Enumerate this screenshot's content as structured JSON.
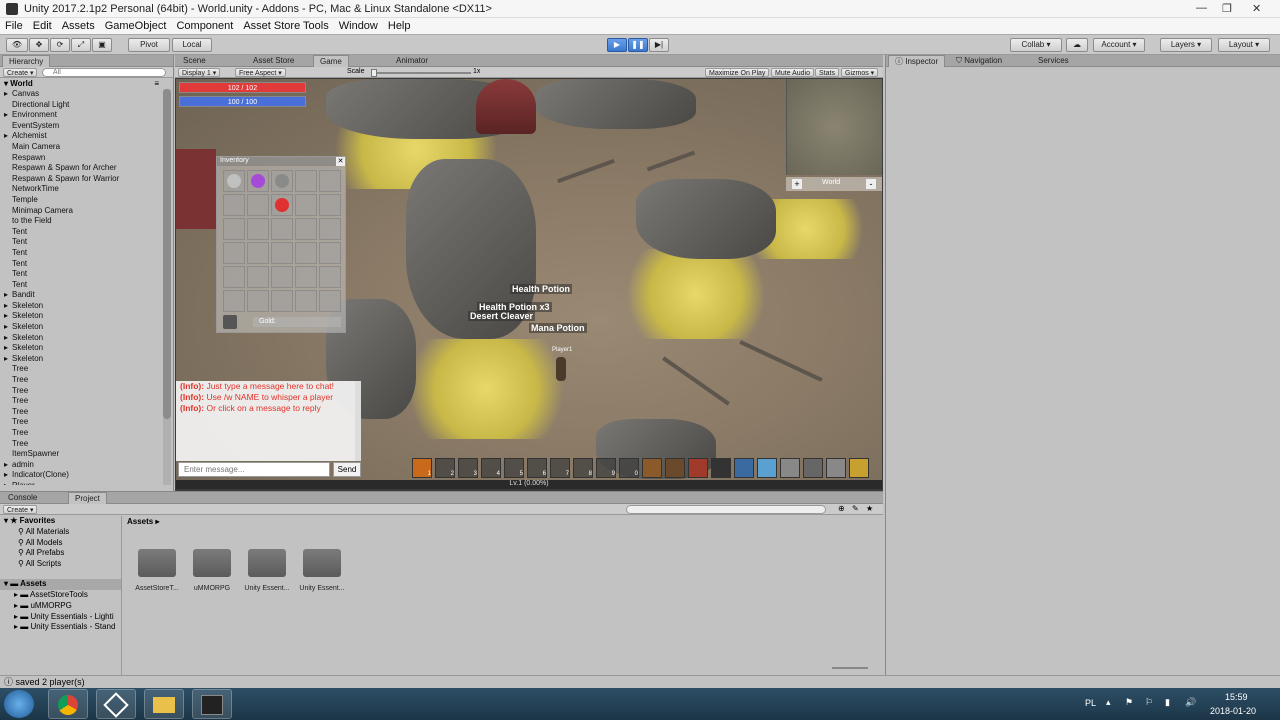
{
  "window": {
    "title": "Unity 2017.2.1p2 Personal (64bit) - World.unity - Addons - PC, Mac & Linux Standalone <DX11>"
  },
  "menu": [
    "File",
    "Edit",
    "Assets",
    "GameObject",
    "Component",
    "Asset Store Tools",
    "Window",
    "Help"
  ],
  "toolbar": {
    "pivot": "Pivot",
    "local": "Local",
    "collab": "Collab",
    "account": "Account",
    "layers": "Layers",
    "layout": "Layout"
  },
  "hierarchy": {
    "tab": "Hierarchy",
    "create": "Create",
    "search_placeholder": "All",
    "scene": "World",
    "items": [
      "Canvas",
      "Directional Light",
      "Environment",
      "EventSystem",
      "Alchemist",
      "Main Camera",
      "Respawn",
      "Respawn & Spawn for Archer",
      "Respawn & Spawn for Warrior",
      "NetworkTime",
      "Temple",
      "Minimap Camera",
      "to the Field",
      "Tent",
      "Tent",
      "Tent",
      "Tent",
      "Tent",
      "Tent",
      "Bandit",
      "Skeleton",
      "Skeleton",
      "Skeleton",
      "Skeleton",
      "Skeleton",
      "Skeleton",
      "Tree",
      "Tree",
      "Tree",
      "Tree",
      "Tree",
      "Tree",
      "Tree",
      "Tree",
      "ItemSpawner",
      "admin",
      "Indicator(Clone)",
      "Player"
    ]
  },
  "view_tabs": [
    "Scene",
    "Asset Store",
    "Game",
    "Animator"
  ],
  "game_bar": {
    "display": "Display 1",
    "aspect": "Free Aspect",
    "scale_label": "Scale",
    "scale": "1x",
    "maximize": "Maximize On Play",
    "mute": "Mute Audio",
    "stats": "Stats",
    "gizmos": "Gizmos"
  },
  "game": {
    "hp": "102 / 102",
    "mp": "100 / 100",
    "inventory_title": "Inventory",
    "gold_label": "Gold:",
    "labels": [
      "Health Potion",
      "Health Potion x3",
      "Desert Cleaver",
      "Mana Potion"
    ],
    "player_name": "Player1",
    "minimap_label": "World",
    "chat": [
      {
        "tag": "(Info):",
        "text": "Just type a message here to chat!"
      },
      {
        "tag": "(Info):",
        "text": "Use /w NAME to whisper a player"
      },
      {
        "tag": "(Info):",
        "text": "Or click on a message to reply"
      }
    ],
    "chat_placeholder": "Enter message...",
    "send": "Send",
    "skill_numbers": [
      "1",
      "2",
      "3",
      "4",
      "5",
      "6",
      "7",
      "8",
      "9",
      "0"
    ],
    "level": "Lv.1 (0.00%)"
  },
  "inspector_tabs": [
    "Inspector",
    "Navigation",
    "Services"
  ],
  "bottom_tabs": [
    "Console",
    "Project"
  ],
  "project": {
    "create": "Create",
    "favorites": "Favorites",
    "fav_items": [
      "All Materials",
      "All Models",
      "All Prefabs",
      "All Scripts"
    ],
    "assets_root": "Assets",
    "tree": [
      "AssetStoreTools",
      "uMMORPG",
      "Unity Essentials - Lighti",
      "Unity Essentials - Stand"
    ],
    "breadcrumb": "Assets",
    "folders": [
      "AssetStoreT...",
      "uMMORPG",
      "Unity Essent...",
      "Unity Essent..."
    ]
  },
  "status": "saved 2 player(s)",
  "taskbar": {
    "lang": "PL",
    "time": "15:59",
    "date": "2018-01-20"
  },
  "colors": {
    "hp": "#e03a3a",
    "mp": "#4a6fd8",
    "play": "#3a78d0"
  }
}
